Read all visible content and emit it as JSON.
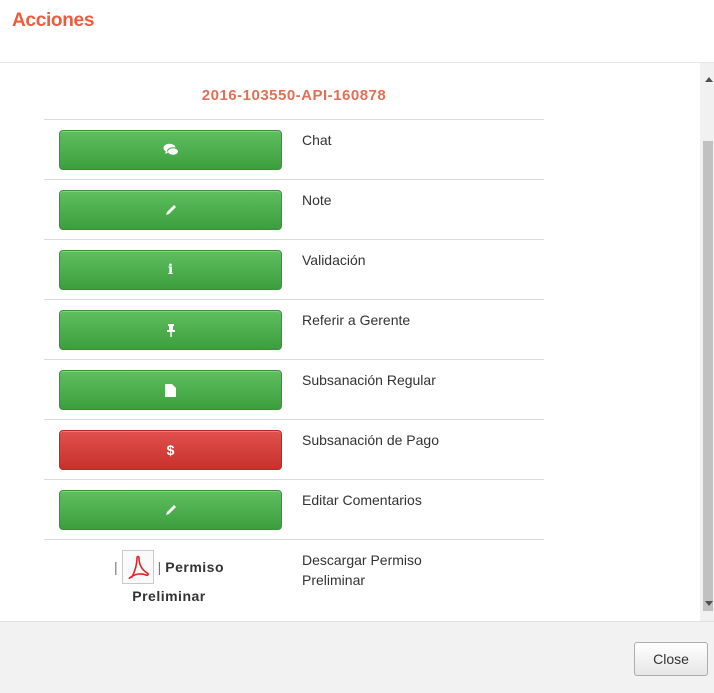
{
  "modal": {
    "title": "Acciones",
    "close_label": "Close"
  },
  "case_id": "2016-103550-API-160878",
  "actions": [
    {
      "icon": "comments-icon",
      "glyph": "💬",
      "label": "Chat",
      "color": "green"
    },
    {
      "icon": "pencil-icon",
      "glyph": "✎",
      "label": "Note",
      "color": "green"
    },
    {
      "icon": "info-icon",
      "glyph": "i",
      "label": "Validación",
      "color": "green"
    },
    {
      "icon": "pin-icon",
      "glyph": "📌",
      "label": "Referir a Gerente",
      "color": "green"
    },
    {
      "icon": "file-icon",
      "glyph": "▮",
      "label": "Subsanación Regular",
      "color": "green"
    },
    {
      "icon": "dollar-icon",
      "glyph": "$",
      "label": "Subsanación de Pago",
      "color": "red"
    },
    {
      "icon": "pencil-icon",
      "glyph": "✎",
      "label": "Editar Comentarios",
      "color": "green"
    }
  ],
  "download": {
    "prefix": "|",
    "sep": "|",
    "link_part1": "Permiso",
    "link_part2": "Preliminar",
    "label": "Descargar Permiso Preliminar"
  },
  "colors": {
    "title": "#ef5b3c",
    "case_id": "#e36f56",
    "green": "#4cae4c",
    "red": "#d9534f"
  }
}
